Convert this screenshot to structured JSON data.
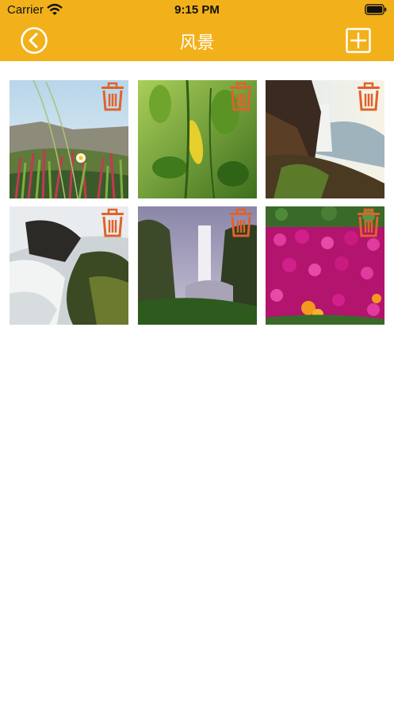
{
  "status_bar": {
    "carrier": "Carrier",
    "time": "9:15 PM"
  },
  "nav": {
    "title": "风景",
    "back_icon": "back-circle-icon",
    "add_icon": "add-square-icon",
    "bar_color": "#f2b01a"
  },
  "photos": [
    {
      "name": "photo-beach-grass-flower",
      "delete_icon": "trash-icon"
    },
    {
      "name": "photo-green-leaves",
      "delete_icon": "trash-icon"
    },
    {
      "name": "photo-coastal-waterfall",
      "delete_icon": "trash-icon"
    },
    {
      "name": "photo-stream-rocks",
      "delete_icon": "trash-icon"
    },
    {
      "name": "photo-tall-waterfall",
      "delete_icon": "trash-icon"
    },
    {
      "name": "photo-pink-flower-field",
      "delete_icon": "trash-icon"
    }
  ],
  "colors": {
    "delete_icon": "#e0622b"
  }
}
